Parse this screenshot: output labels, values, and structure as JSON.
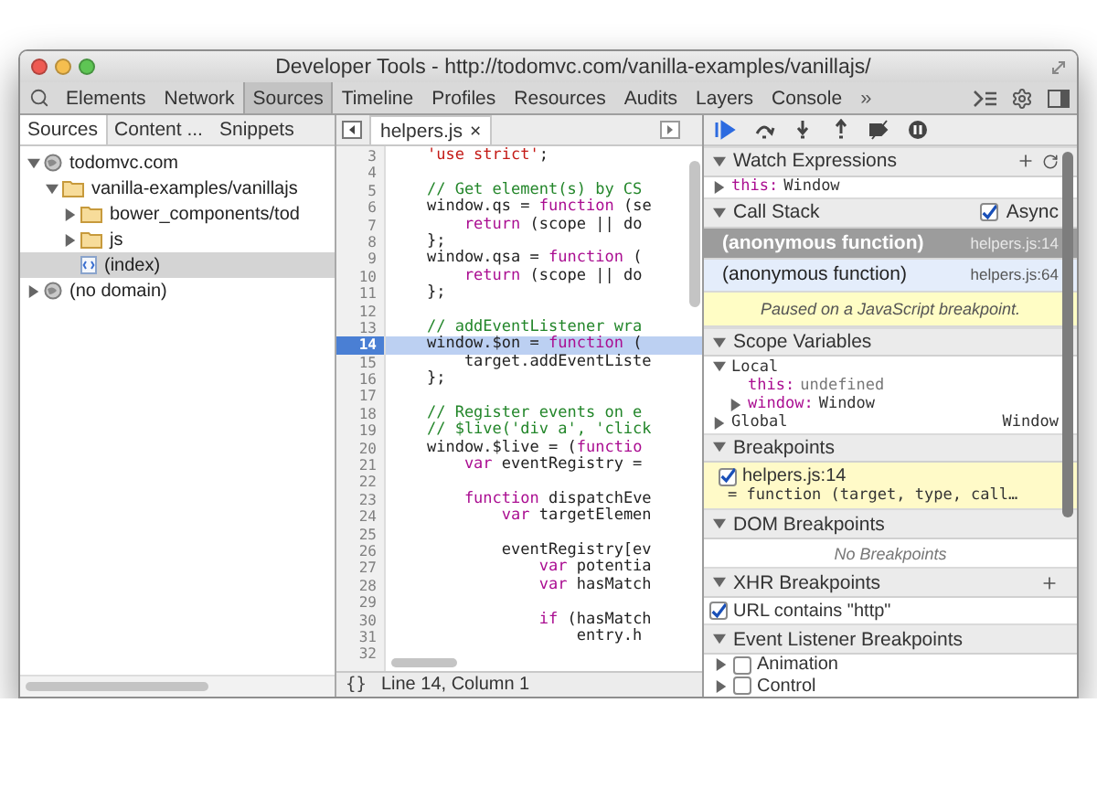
{
  "window": {
    "title": "Developer Tools - http://todomvc.com/vanilla-examples/vanillajs/"
  },
  "toolbar": {
    "tabs": [
      {
        "label": "Elements",
        "selected": false
      },
      {
        "label": "Network",
        "selected": false
      },
      {
        "label": "Sources",
        "selected": true
      },
      {
        "label": "Timeline",
        "selected": false
      },
      {
        "label": "Profiles",
        "selected": false
      },
      {
        "label": "Resources",
        "selected": false
      },
      {
        "label": "Audits",
        "selected": false
      },
      {
        "label": "Layers",
        "selected": false
      },
      {
        "label": "Console",
        "selected": false
      }
    ],
    "overflow": "»"
  },
  "navigator": {
    "tabs": [
      {
        "label": "Sources",
        "selected": true
      },
      {
        "label": "Content ...",
        "selected": false
      },
      {
        "label": "Snippets",
        "selected": false
      }
    ],
    "tree": [
      {
        "label": "todomvc.com",
        "kind": "domain",
        "expanded": true,
        "selected": false,
        "children": [
          {
            "label": "vanilla-examples/vanillajs",
            "kind": "folder",
            "expanded": true,
            "selected": false,
            "children": [
              {
                "label": "bower_components/tod",
                "kind": "folder",
                "expanded": false,
                "selected": false
              },
              {
                "label": "js",
                "kind": "folder",
                "expanded": false,
                "selected": false
              },
              {
                "label": "(index)",
                "kind": "file",
                "selected": true
              }
            ]
          }
        ]
      },
      {
        "label": "(no domain)",
        "kind": "domain",
        "expanded": false,
        "selected": false
      }
    ]
  },
  "editor": {
    "tabs": [
      {
        "label": "helpers.js",
        "close": "×",
        "selected": true
      }
    ],
    "lines": [
      {
        "number": "3",
        "breakpoint": false,
        "segments": [
          {
            "kind": "string",
            "text": "    'use strict'"
          },
          {
            "kind": "text",
            "text": ";"
          }
        ]
      },
      {
        "number": "4",
        "breakpoint": false
      },
      {
        "number": "5",
        "breakpoint": false,
        "segments": [
          {
            "kind": "comment",
            "text": "    // Get element(s) by CS"
          }
        ]
      },
      {
        "number": "6",
        "breakpoint": false,
        "segments": [
          {
            "kind": "text",
            "text": "    window.qs = "
          },
          {
            "kind": "keyword",
            "text": "function"
          },
          {
            "kind": "text",
            "text": " (se"
          }
        ]
      },
      {
        "number": "7",
        "breakpoint": false,
        "segments": [
          {
            "kind": "keyword",
            "text": "        return"
          },
          {
            "kind": "text",
            "text": " (scope || do"
          }
        ]
      },
      {
        "number": "8",
        "breakpoint": false,
        "segments": [
          {
            "kind": "text",
            "text": "    };"
          }
        ]
      },
      {
        "number": "9",
        "breakpoint": false,
        "segments": [
          {
            "kind": "text",
            "text": "    window.qsa = "
          },
          {
            "kind": "keyword",
            "text": "function"
          },
          {
            "kind": "text",
            "text": " ("
          }
        ]
      },
      {
        "number": "10",
        "breakpoint": false,
        "segments": [
          {
            "kind": "keyword",
            "text": "        return"
          },
          {
            "kind": "text",
            "text": " (scope || do"
          }
        ]
      },
      {
        "number": "11",
        "breakpoint": false,
        "segments": [
          {
            "kind": "text",
            "text": "    };"
          }
        ]
      },
      {
        "number": "12",
        "breakpoint": false
      },
      {
        "number": "13",
        "breakpoint": false,
        "segments": [
          {
            "kind": "comment",
            "text": "    // addEventListener wra"
          }
        ]
      },
      {
        "number": "14",
        "breakpoint": true,
        "segments": [
          {
            "kind": "text",
            "text": "    window.$on = "
          },
          {
            "kind": "keyword",
            "text": "function"
          },
          {
            "kind": "text",
            "text": " ("
          }
        ]
      },
      {
        "number": "15",
        "breakpoint": false,
        "segments": [
          {
            "kind": "text",
            "text": "        target.addEventListe"
          }
        ]
      },
      {
        "number": "16",
        "breakpoint": false,
        "segments": [
          {
            "kind": "text",
            "text": "    };"
          }
        ]
      },
      {
        "number": "17",
        "breakpoint": false
      },
      {
        "number": "18",
        "breakpoint": false,
        "segments": [
          {
            "kind": "comment",
            "text": "    // Register events on e"
          }
        ]
      },
      {
        "number": "19",
        "breakpoint": false,
        "segments": [
          {
            "kind": "comment",
            "text": "    // $live('div a', 'click"
          }
        ]
      },
      {
        "number": "20",
        "breakpoint": false,
        "segments": [
          {
            "kind": "text",
            "text": "    window.$live = ("
          },
          {
            "kind": "keyword",
            "text": "functio"
          }
        ]
      },
      {
        "number": "21",
        "breakpoint": false,
        "segments": [
          {
            "kind": "keyword",
            "text": "        var"
          },
          {
            "kind": "text",
            "text": " eventRegistry ="
          }
        ]
      },
      {
        "number": "22",
        "breakpoint": false
      },
      {
        "number": "23",
        "breakpoint": false,
        "segments": [
          {
            "kind": "keyword",
            "text": "        function"
          },
          {
            "kind": "text",
            "text": " dispatchEve"
          }
        ]
      },
      {
        "number": "24",
        "breakpoint": false,
        "segments": [
          {
            "kind": "keyword",
            "text": "            var"
          },
          {
            "kind": "text",
            "text": " targetElemen"
          }
        ]
      },
      {
        "number": "25",
        "breakpoint": false
      },
      {
        "number": "26",
        "breakpoint": false,
        "segments": [
          {
            "kind": "text",
            "text": "            eventRegistry[ev"
          }
        ]
      },
      {
        "number": "27",
        "breakpoint": false,
        "segments": [
          {
            "kind": "keyword",
            "text": "                var"
          },
          {
            "kind": "text",
            "text": " potentia"
          }
        ]
      },
      {
        "number": "28",
        "breakpoint": false,
        "segments": [
          {
            "kind": "keyword",
            "text": "                var"
          },
          {
            "kind": "text",
            "text": " hasMatch"
          }
        ]
      },
      {
        "number": "29",
        "breakpoint": false
      },
      {
        "number": "30",
        "breakpoint": false,
        "segments": [
          {
            "kind": "keyword",
            "text": "                if"
          },
          {
            "kind": "text",
            "text": " (hasMatch"
          }
        ]
      },
      {
        "number": "31",
        "breakpoint": false,
        "segments": [
          {
            "kind": "text",
            "text": "                    entry.h"
          }
        ]
      },
      {
        "number": "32",
        "breakpoint": false
      }
    ],
    "format_button": "{}",
    "status": "Line 14, Column 1"
  },
  "debugger": {
    "watch": {
      "title": "Watch Expressions",
      "expanded": true,
      "items": [
        {
          "name": "this:",
          "value": "Window",
          "expanded": false
        }
      ]
    },
    "call_stack": {
      "title": "Call Stack",
      "expanded": true,
      "async": {
        "label": "Async",
        "checked": true
      },
      "frames": [
        {
          "name": "(anonymous function)",
          "location": "helpers.js:14",
          "selected": true
        },
        {
          "name": "(anonymous function)",
          "location": "helpers.js:64",
          "selected": false
        }
      ],
      "message": "Paused on a JavaScript breakpoint."
    },
    "scope": {
      "title": "Scope Variables",
      "expanded": true,
      "scopes": [
        {
          "name": "Local",
          "expanded": true,
          "variables": [
            {
              "name": "this:",
              "value": "undefined",
              "expandable": false
            },
            {
              "name": "window:",
              "value": "Window",
              "expandable": true
            }
          ]
        },
        {
          "name": "Global",
          "expanded": false,
          "value": "Window"
        }
      ]
    },
    "breakpoints": {
      "title": "Breakpoints",
      "expanded": true,
      "items": [
        {
          "label": "helpers.js:14",
          "checked": true,
          "snippet": "= function (target, type, call…"
        }
      ]
    },
    "dom_breakpoints": {
      "title": "DOM Breakpoints",
      "expanded": true,
      "empty": "No Breakpoints"
    },
    "xhr_breakpoints": {
      "title": "XHR Breakpoints",
      "expanded": true,
      "items": [
        {
          "label": "URL contains \"http\"",
          "checked": true
        }
      ]
    },
    "event_breakpoints": {
      "title": "Event Listener Breakpoints",
      "expanded": true,
      "items": [
        {
          "label": "Animation",
          "checked": false,
          "expanded": false
        },
        {
          "label": "Control",
          "checked": false,
          "expanded": false
        }
      ]
    }
  }
}
